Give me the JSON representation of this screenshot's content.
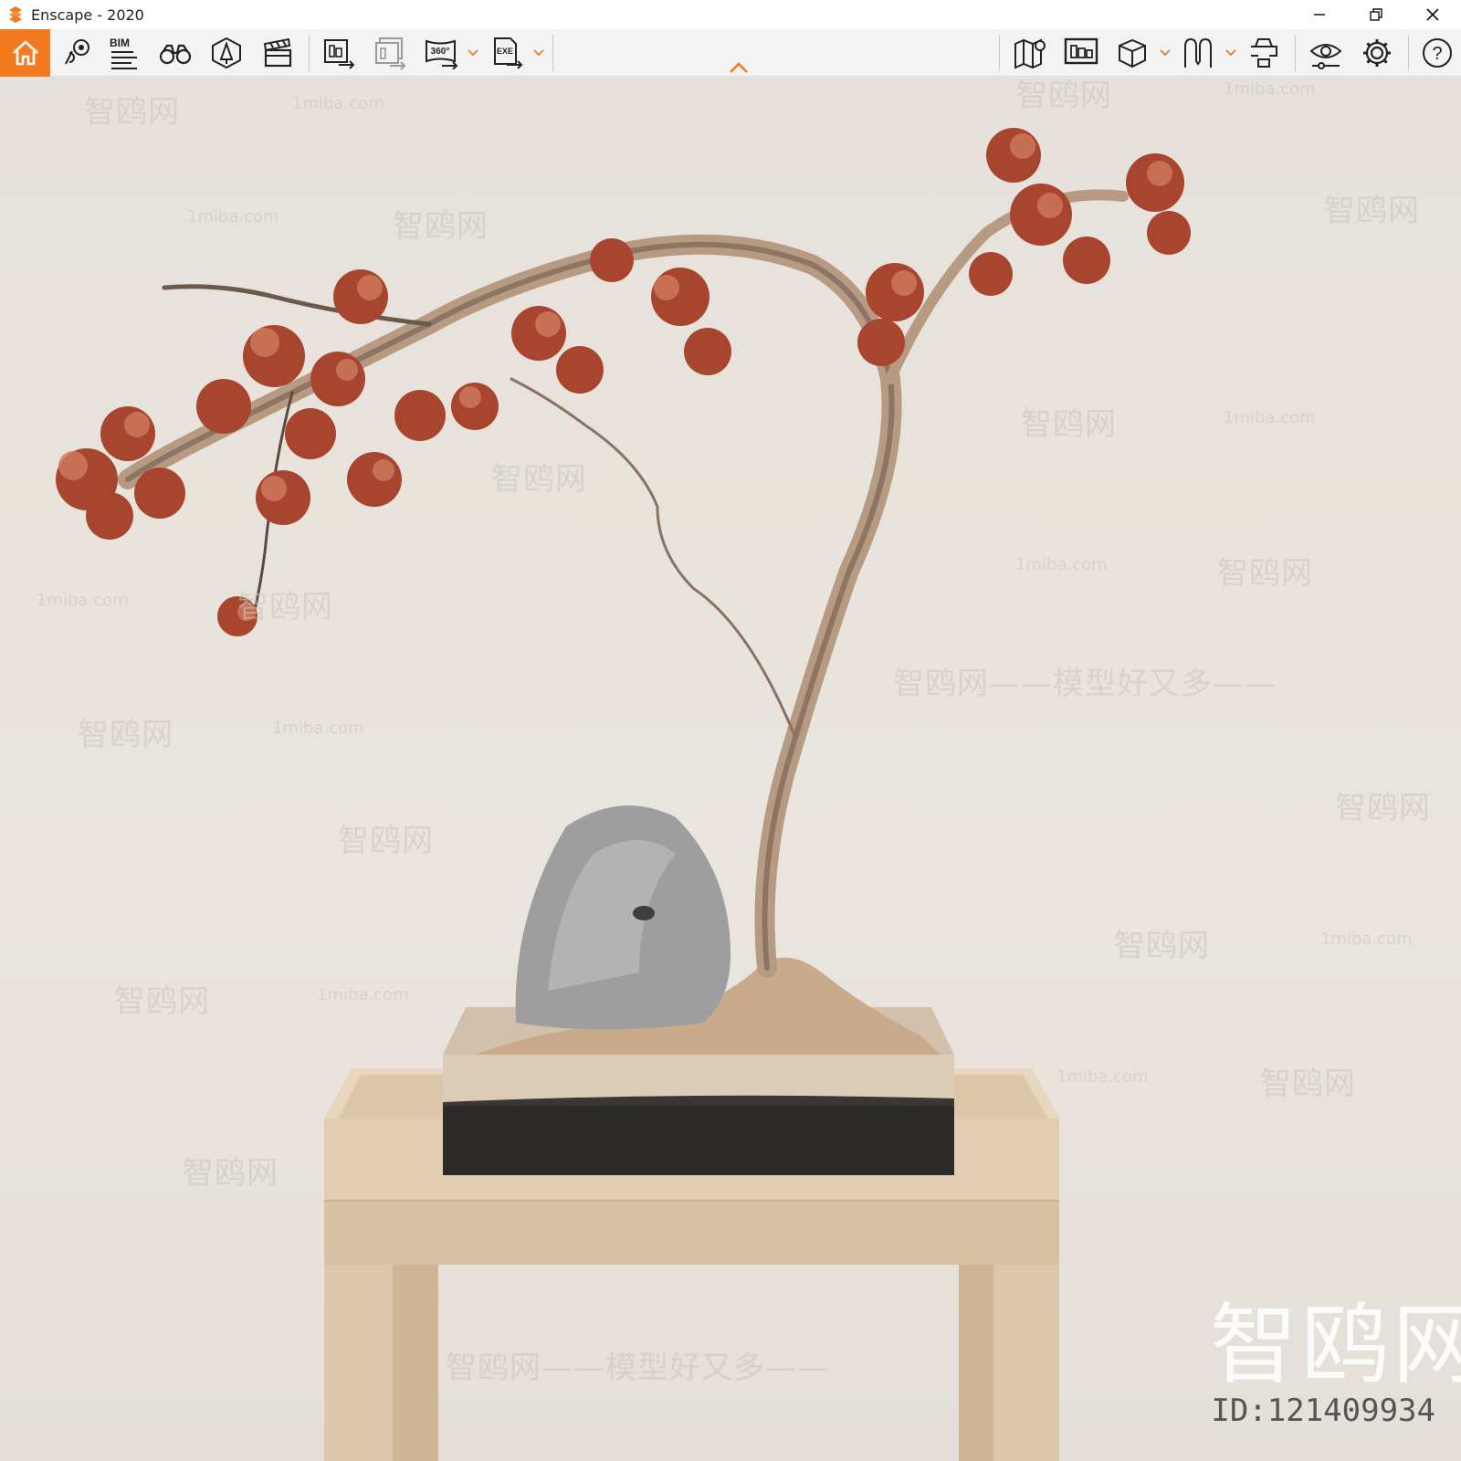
{
  "window": {
    "title": "Enscape - 2020",
    "accent": "#f47a20"
  },
  "toolbar": {
    "items": [
      {
        "name": "home-button",
        "icon": "home-icon",
        "label": ""
      },
      {
        "name": "location-pins-button",
        "icon": "pin-icon",
        "label": ""
      },
      {
        "name": "bim-button",
        "icon": "bim-icon",
        "label": "BIM"
      },
      {
        "name": "views-button",
        "icon": "binoculars-icon",
        "label": ""
      },
      {
        "name": "assets-button",
        "icon": "asset-icon",
        "label": ""
      },
      {
        "name": "video-editor-button",
        "icon": "clapper-icon",
        "label": ""
      },
      {
        "name": "render-image-button",
        "icon": "render-icon",
        "label": ""
      },
      {
        "name": "batch-render-button",
        "icon": "batch-render-icon",
        "label": ""
      },
      {
        "name": "panorama-button",
        "icon": "panorama-icon",
        "label": "360°"
      },
      {
        "name": "export-exe-button",
        "icon": "exe-icon",
        "label": "EXE"
      },
      {
        "name": "map-button",
        "icon": "map-icon",
        "label": ""
      },
      {
        "name": "screenshot-button",
        "icon": "screen-icon",
        "label": ""
      },
      {
        "name": "material-editor-button",
        "icon": "cube-icon",
        "label": ""
      },
      {
        "name": "vr-button",
        "icon": "vr-icon",
        "label": ""
      },
      {
        "name": "upload-button",
        "icon": "upload-icon",
        "label": ""
      },
      {
        "name": "visual-settings-button",
        "icon": "eye-icon",
        "label": ""
      },
      {
        "name": "settings-button",
        "icon": "gear-icon",
        "label": ""
      },
      {
        "name": "help-button",
        "icon": "help-icon",
        "label": "?"
      }
    ]
  },
  "watermarks": {
    "site": "1miba.com",
    "brand": "智鸥网",
    "brand_dash": "智鸥网——模型好又多——",
    "big": "智鸥网",
    "id_text": "ID:121409934"
  }
}
